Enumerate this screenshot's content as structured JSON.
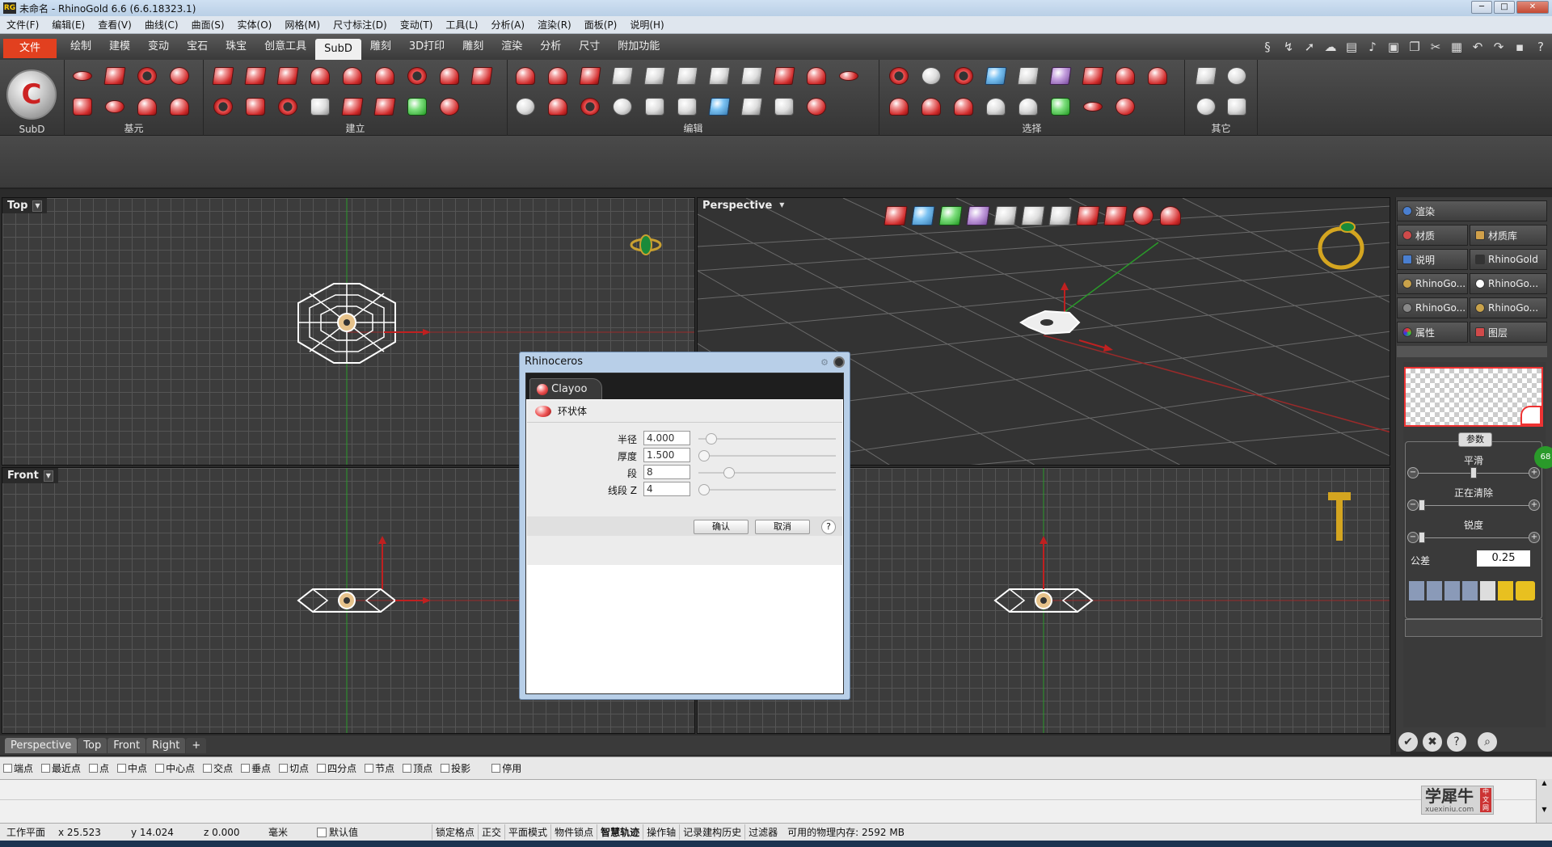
{
  "window": {
    "title": "未命名 - RhinoGold 6.6 (6.6.18323.1)",
    "app_icon": "RG",
    "minimize": "─",
    "maximize": "□",
    "close": "✕"
  },
  "menu": [
    "文件(F)",
    "编辑(E)",
    "查看(V)",
    "曲线(C)",
    "曲面(S)",
    "实体(O)",
    "网格(M)",
    "尺寸标注(D)",
    "变动(T)",
    "工具(L)",
    "分析(A)",
    "渲染(R)",
    "面板(P)",
    "说明(H)"
  ],
  "ribbon_tabs": [
    "文件",
    "绘制",
    "建模",
    "变动",
    "宝石",
    "珠宝",
    "创意工具",
    "SubD",
    "雕刻",
    "3D打印",
    "雕刻",
    "渲染",
    "分析",
    "尺寸",
    "附加功能"
  ],
  "ribbon_active": "SubD",
  "ribbon_groups": {
    "subd": "SubD",
    "primitives": "基元",
    "create": "建立",
    "edit": "编辑",
    "select": "选择",
    "other": "其它"
  },
  "viewports": {
    "top": "Top",
    "perspective": "Perspective",
    "front": "Front"
  },
  "dialog": {
    "title": "Rhinoceros",
    "tab": "Clayoo",
    "heading": "环状体",
    "fields": [
      {
        "label": "半径",
        "value": "4.000",
        "knob": 0.06
      },
      {
        "label": "厚度",
        "value": "1.500",
        "knob": 0.0
      },
      {
        "label": "段",
        "value": "8",
        "knob": 0.2
      },
      {
        "label": "线段 Z",
        "value": "4",
        "knob": 0.0
      }
    ],
    "ok": "确认",
    "cancel": "取消",
    "help": "?"
  },
  "right_panel": {
    "tabs": [
      "渲染",
      "材质",
      "材质库",
      "说明",
      "RhinoGold",
      "RhinoGo...",
      "RhinoGo...",
      "RhinoGo...",
      "RhinoGo...",
      "属性",
      "图层"
    ],
    "params_title": "参数",
    "smooth": "平滑",
    "clearing": "正在清除",
    "sharpness": "锐度",
    "tolerance_label": "公差",
    "tolerance_value": "0.25",
    "badge": "68"
  },
  "view_tabs": [
    "Perspective",
    "Top",
    "Front",
    "Right",
    "+"
  ],
  "view_tab_active": "Perspective",
  "osnaps": [
    "端点",
    "最近点",
    "点",
    "中点",
    "中心点",
    "交点",
    "垂点",
    "切点",
    "四分点",
    "节点",
    "顶点",
    "投影",
    "停用"
  ],
  "watermark": {
    "text": "学犀牛",
    "url": "xuexiniu.com",
    "stamp": "中文网"
  },
  "status": {
    "cplane": "工作平面",
    "x": "x 25.523",
    "y": "y 14.024",
    "z": "z 0.000",
    "units": "毫米",
    "layer": "默认值",
    "buttons": [
      "锁定格点",
      "正交",
      "平面模式",
      "物件锁点",
      "智慧轨迹",
      "操作轴",
      "记录建构历史",
      "过滤器"
    ],
    "active_button": "智慧轨迹",
    "memory": "可用的物理内存: 2592 MB"
  },
  "colors": {
    "accent": "#e2401f",
    "subd_red": "#d12d2d",
    "axis_x": "#c02020",
    "axis_y": "#20a020"
  }
}
